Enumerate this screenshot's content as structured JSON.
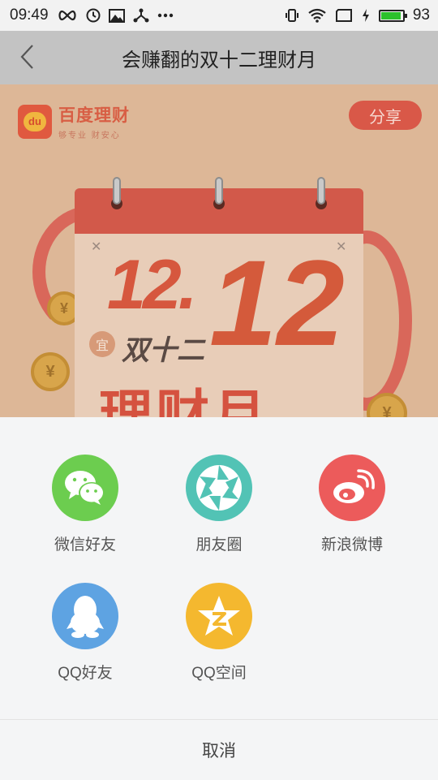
{
  "status_bar": {
    "time": "09:49",
    "battery": "93",
    "battery_level": 0.93,
    "icons_left": [
      "infinity-icon",
      "clock-icon",
      "image-icon",
      "share-network-icon",
      "more-dots-icon"
    ],
    "icons_right": [
      "vibrate-icon",
      "wifi-icon",
      "screen-icon",
      "charging-icon",
      "battery-icon"
    ]
  },
  "title_bar": {
    "title": "会赚翻的双十二理财月"
  },
  "banner": {
    "brand_name": "百度理财",
    "brand_slogan": "够专业 财安心",
    "logo_text": "du",
    "share_label": "分享",
    "big_number_left": "12.",
    "big_number_right": "12",
    "yi_badge": "宜",
    "subtitle": "双十二",
    "headline": "理财月"
  },
  "share_sheet": {
    "items": [
      {
        "label": "微信好友",
        "icon": "wechat-icon",
        "color": "#6ccd4f"
      },
      {
        "label": "朋友圈",
        "icon": "moments-icon",
        "color": "#52c3b5"
      },
      {
        "label": "新浪微博",
        "icon": "weibo-icon",
        "color": "#ec5b5b"
      },
      {
        "label": "QQ好友",
        "icon": "qq-icon",
        "color": "#5ea3e2"
      },
      {
        "label": "QQ空间",
        "icon": "qzone-icon",
        "color": "#f4b82f"
      }
    ],
    "cancel_label": "取消"
  },
  "colors": {
    "accent": "#d95848",
    "sheet_background": "#f4f5f6"
  }
}
